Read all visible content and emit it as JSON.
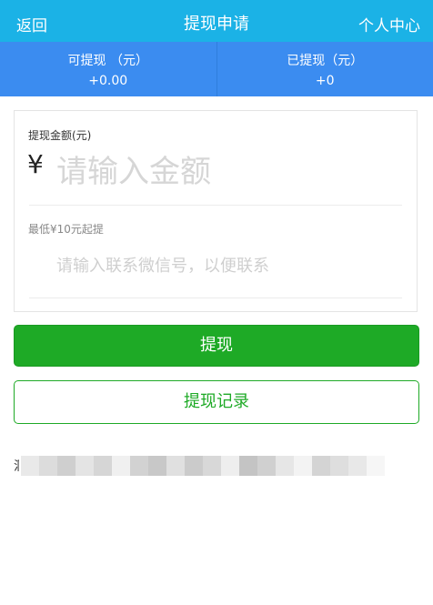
{
  "header": {
    "back_label": "返回",
    "title": "提现申请",
    "user_center_label": "个人中心"
  },
  "stats": {
    "available_label": "可提现 （元）",
    "available_value": "+0.00",
    "withdrawn_label": "已提现（元）",
    "withdrawn_value": "+0"
  },
  "form": {
    "amount_label": "提现金额(元)",
    "currency_symbol": "¥",
    "amount_placeholder": "请输入金额",
    "min_note": "最低¥10元起提",
    "wechat_placeholder": "请输入联系微信号，以便联系"
  },
  "actions": {
    "withdraw_label": "提现",
    "records_label": "提现记录"
  },
  "footer": {
    "blurred_lead_char": "洞"
  },
  "colors": {
    "header_bg": "#1bb2e6",
    "stats_bg": "#3b8cf0",
    "primary_green": "#1eaa26"
  }
}
